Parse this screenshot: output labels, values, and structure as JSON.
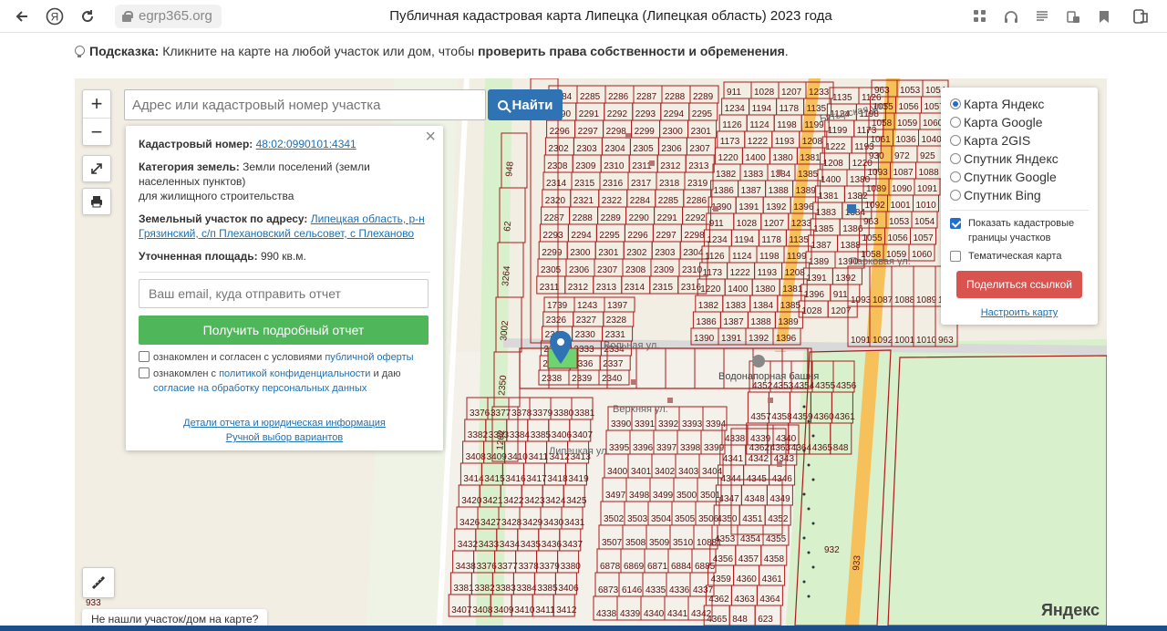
{
  "browser": {
    "url": "egrp365.org",
    "title": "Публичная кадастровая карта Липецка (Липецкая область) 2023 года"
  },
  "hint": {
    "label": "Подсказка:",
    "text": "Кликните на карте на любой участок или дом, чтобы",
    "bold": "проверить права собственности и обременения",
    "end": "."
  },
  "search": {
    "placeholder": "Адрес или кадастровый номер участка",
    "button": "Найти"
  },
  "zoom": {
    "in": "+",
    "out": "−"
  },
  "info": {
    "cad_label": "Кадастровый номер:",
    "cad_value": "48:02:0990101:4341",
    "cat_label": "Категория земель:",
    "cat_value": "Земли поселений (земли населенных пунктов)",
    "cat_value2": "для жилищного строительства",
    "addr_label": "Земельный участок по адресу:",
    "addr_value": "Липецкая область, р-н Грязинский, с/п Плехановский сельсовет, с Плеханово",
    "area_label": "Уточненная площадь:",
    "area_value": "990 кв.м.",
    "email_placeholder": "Ваш email, куда отправить отчет",
    "report_button": "Получить подробный отчет",
    "agree1_text": "ознакомлен и согласен с условиями",
    "agree1_link": "публичной оферты",
    "agree2_text": "ознакомлен с",
    "agree2_link": "политикой конфиденциальности",
    "agree2_mid": "и даю",
    "agree2_link2": "согласие на обработку персональных данных",
    "details_link": "Детали отчета и юридическая информация",
    "manual_link": "Ручной выбор вариантов"
  },
  "layers": {
    "options": [
      "Карта Яндекс",
      "Карта Google",
      "Карта 2GIS",
      "Спутник Яндекс",
      "Спутник Google",
      "Спутник Bing"
    ],
    "selected": "Карта Яндекс",
    "show_borders": "Показать кадастровые границы участков",
    "thematic": "Тематическая карта",
    "share_button": "Поделиться ссылкой",
    "configure_link": "Настроить карту"
  },
  "map": {
    "not_found": "Не нашли участок/дом на карте?",
    "logo": "Яндекс",
    "streets": [
      "Бутырская ул.",
      "Парковая ул.",
      "Вольная ул.",
      "Верхняя ул.",
      "Липецкая ул."
    ],
    "poi": "Водонапорная башня",
    "parcels_a": [
      "2284",
      "2285",
      "2286",
      "2287",
      "2288",
      "2289",
      "2290",
      "2291",
      "2292",
      "2293",
      "2294",
      "2295",
      "2296",
      "2297",
      "2298",
      "2299",
      "2300",
      "2301",
      "2302",
      "2303",
      "2304",
      "2305",
      "2306",
      "2307",
      "2308",
      "2309",
      "2310",
      "2311",
      "2312",
      "2313",
      "2314",
      "2315",
      "2316",
      "2317",
      "2318",
      "2319",
      "2320",
      "2321",
      "2322"
    ],
    "parcels_b": [
      "1739",
      "1243",
      "1397",
      "2326",
      "2327",
      "2328",
      "2329",
      "2330",
      "2331",
      "2332",
      "2333",
      "2334",
      "2335",
      "2336",
      "2337",
      "2338",
      "2339",
      "2340",
      "2341",
      "2342",
      "2343",
      "2344",
      "2345",
      "2346",
      "2347",
      "2348",
      "2349",
      "2350",
      "2323",
      "2324",
      "2325",
      "10864"
    ],
    "parcels_c": [
      "911",
      "1028",
      "1207",
      "1233",
      "1234",
      "1194",
      "1178",
      "1135",
      "1126",
      "1124",
      "1198",
      "1199",
      "1173",
      "1222",
      "1193",
      "1208",
      "1220",
      "1400",
      "1380",
      "1381",
      "1382",
      "1383",
      "1384",
      "1385",
      "1386",
      "1387",
      "1388",
      "1389",
      "1390",
      "1391",
      "1392",
      "1396"
    ],
    "parcels_d": [
      "963",
      "1053",
      "1054",
      "1055",
      "1056",
      "1057",
      "1058",
      "1059",
      "1060",
      "1061",
      "1036",
      "1040",
      "930",
      "972",
      "925",
      "1093",
      "1087",
      "1088",
      "1089",
      "1090",
      "1091",
      "1092",
      "1001",
      "1010"
    ],
    "parcels_e": [
      "3376",
      "3377",
      "3378",
      "3379",
      "3380",
      "3381",
      "3382",
      "3383",
      "3384",
      "3385",
      "3406",
      "3407",
      "3408",
      "3409",
      "3410",
      "3411",
      "3412",
      "3413",
      "3414",
      "3415",
      "3416",
      "3417",
      "3418",
      "3419",
      "3420",
      "3421",
      "3422",
      "3423",
      "3424",
      "3425",
      "3426",
      "3427",
      "3428",
      "3429",
      "3430",
      "3431",
      "3432",
      "3433",
      "3434",
      "3435",
      "3436",
      "3437",
      "3438"
    ],
    "parcels_f": [
      "3390",
      "3391",
      "3392",
      "3393",
      "3394",
      "3395",
      "3396",
      "3397",
      "3398",
      "3399",
      "3400",
      "3401",
      "3402",
      "3403",
      "3404",
      "3497",
      "3498",
      "3499",
      "3500",
      "3501",
      "3502",
      "3503",
      "3504",
      "3505",
      "3506",
      "3507",
      "3508",
      "3509",
      "3510",
      "10881",
      "6878",
      "6869",
      "6871",
      "6884",
      "6885",
      "6873",
      "6146",
      "4335",
      "4336",
      "4337",
      "4338",
      "4339",
      "4340",
      "4341",
      "4342",
      "4343",
      "4344",
      "4345",
      "4346",
      "4347",
      "4348",
      "4349",
      "4350",
      "4351",
      "4352",
      "4353",
      "4354",
      "4355",
      "4356",
      "4357",
      "4358",
      "4359",
      "4360",
      "4361",
      "4362",
      "4363",
      "4364",
      "4365",
      "848",
      "623",
      "872",
      "1169",
      "1140",
      "1070",
      "1388",
      "2323",
      "932",
      "933",
      "948",
      "62",
      "3264",
      "3002",
      "2350",
      "1262",
      "1266",
      "3006",
      "1216",
      "1217",
      "1218",
      "1219",
      "1223",
      "1224",
      "1225",
      "1226",
      "1227",
      "1228",
      "1175",
      "1176",
      "1177",
      "1180",
      "1182",
      "1183",
      "1184",
      "1185",
      "1186",
      "1187",
      "1188",
      "1189",
      "1190",
      "1191",
      "1192"
    ]
  },
  "colors": {
    "parcel": "#a81c1c",
    "road": "#f6c15a",
    "green": "#d8f0cc",
    "selected": "#6fd36f",
    "accent": "#2f73b5"
  }
}
